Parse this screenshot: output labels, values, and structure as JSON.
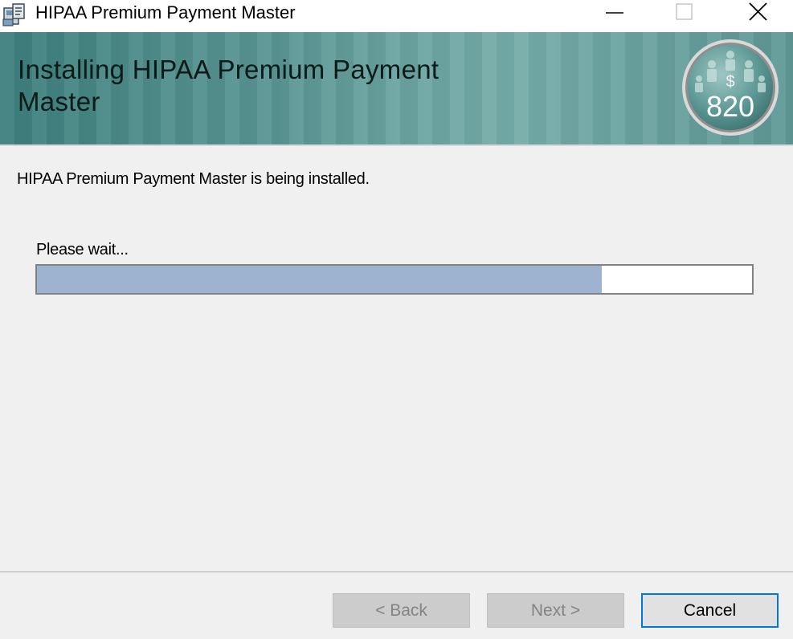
{
  "window": {
    "title": "HIPAA Premium Payment Master"
  },
  "banner": {
    "heading": "Installing HIPAA Premium Payment Master",
    "logo": {
      "symbol": "$",
      "number": "820"
    }
  },
  "main": {
    "status": "HIPAA Premium Payment Master is being installed.",
    "wait_label": "Please wait...",
    "progress_percent": 79
  },
  "buttons": {
    "back": "< Back",
    "next": "Next >",
    "cancel": "Cancel"
  },
  "icons": [
    "installer-app-icon",
    "minimize-icon",
    "maximize-icon",
    "close-icon",
    "company-logo-icon"
  ],
  "colors": {
    "progress_fill": "#9db3cf",
    "banner_teal": "#5a9694",
    "focus_border": "#0078d7"
  }
}
